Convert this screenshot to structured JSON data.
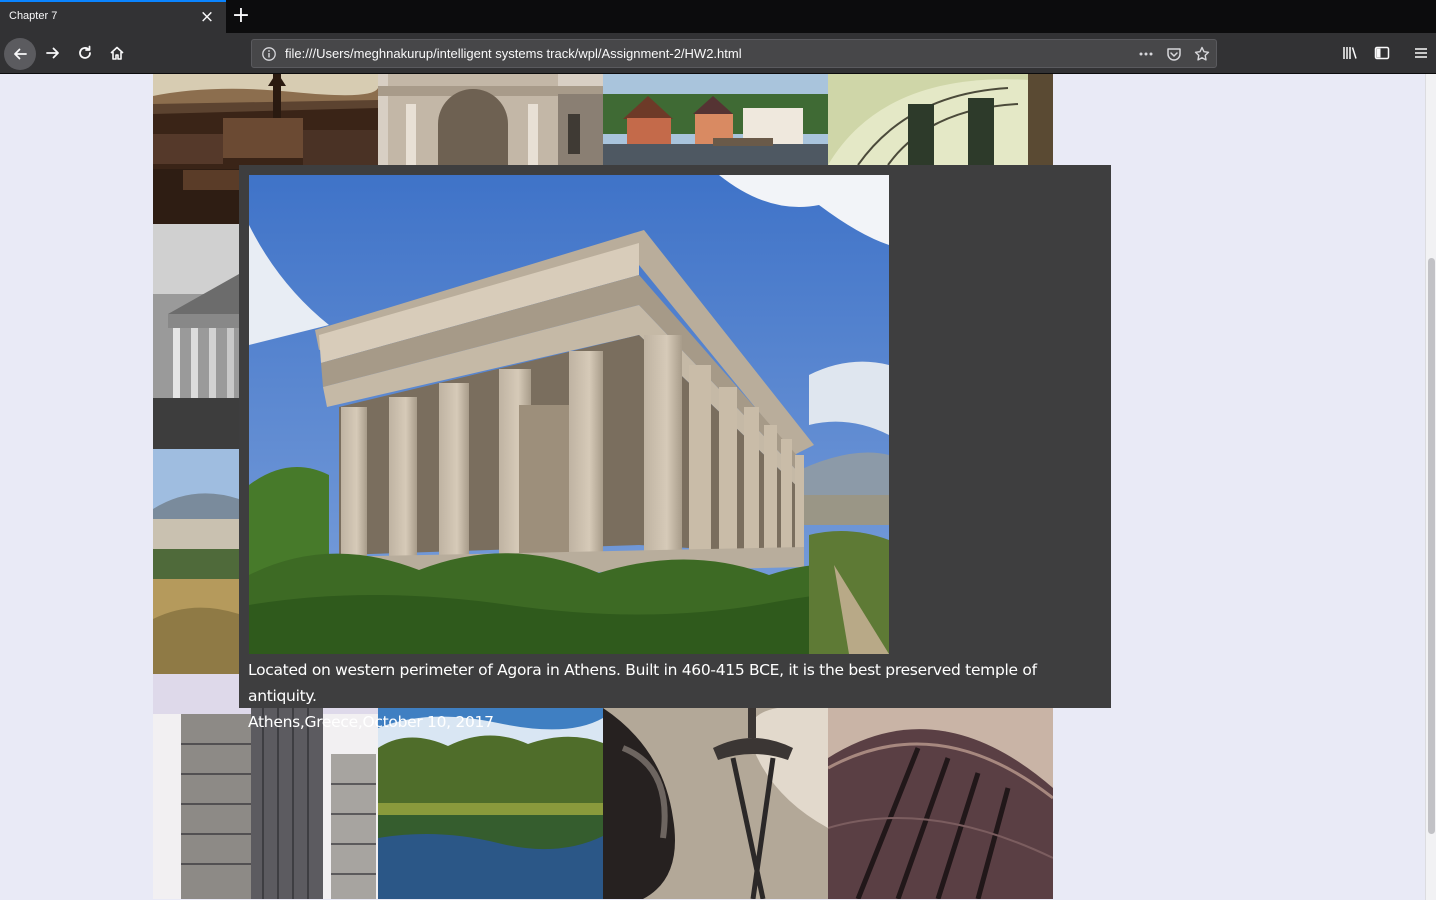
{
  "browser": {
    "tab_title": "Chapter 7",
    "tab_close_icon": "close-icon",
    "new_tab_icon": "plus-icon",
    "url": "file:///Users/meghnakurup/intelligent systems track/wpl/Assignment-2/HW2.html",
    "nav_icons": [
      "back-arrow-icon",
      "forward-arrow-icon",
      "reload-icon",
      "home-icon"
    ],
    "url_icons": [
      "info-icon",
      "more-icon",
      "pocket-icon",
      "bookmark-star-icon"
    ],
    "right_icons": [
      "library-icon",
      "sidebar-icon",
      "menu-icon"
    ]
  },
  "gallery": {
    "thumbnails": [
      {
        "subject": "city river aerial"
      },
      {
        "subject": "triumphal arch"
      },
      {
        "subject": "harbor town"
      },
      {
        "subject": "museum dome"
      },
      {
        "subject": "greek temple black and white"
      },
      {
        "subject": "hillside city view"
      },
      {
        "subject": "glass skyscrapers"
      },
      {
        "subject": "park pond"
      },
      {
        "subject": "space needle"
      },
      {
        "subject": "curved metal building"
      }
    ]
  },
  "popup": {
    "image_subject": "Temple of Hephaestus",
    "caption_line1": "Located on western perimeter of Agora in Athens. Built in 460-415 BCE, it is the best preserved temple of antiquity.",
    "caption_line2": "Athens,Greece,October 10, 2017"
  },
  "colors": {
    "accent": "#0a84ff",
    "toolbar": "#323234",
    "page_background": "#e9eaf6",
    "popup_background": "#3e3e3f"
  }
}
